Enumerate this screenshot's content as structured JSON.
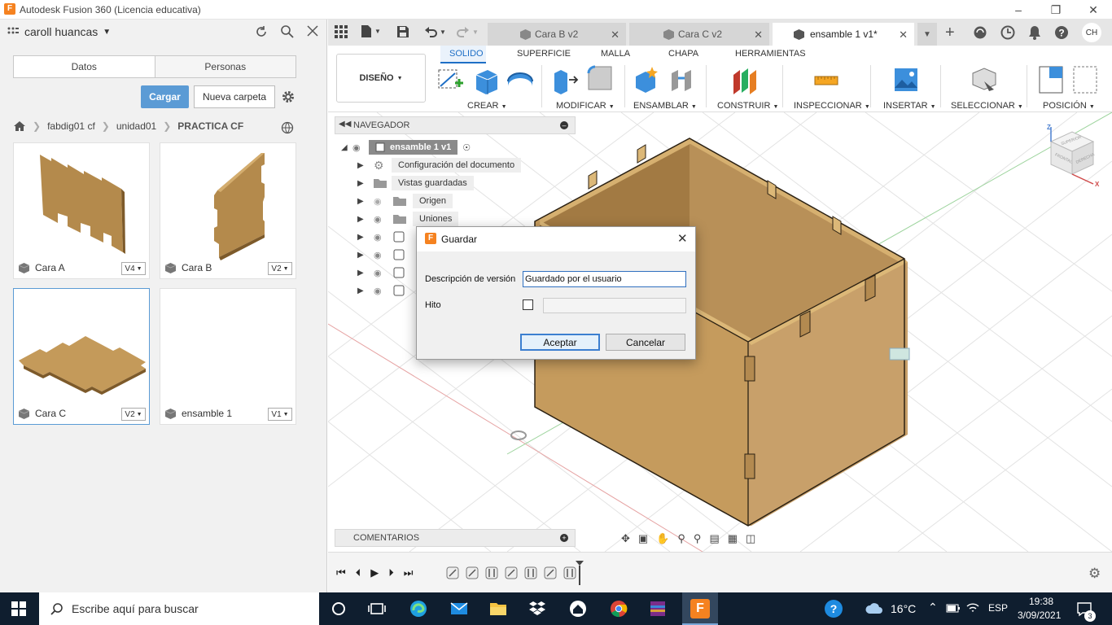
{
  "window": {
    "title": "Autodesk Fusion 360 (Licencia educativa)"
  },
  "left_panel": {
    "user": "caroll huancas",
    "tabs": [
      "Datos",
      "Personas"
    ],
    "upload_button": "Cargar",
    "new_folder_button": "Nueva carpeta",
    "breadcrumb": [
      "fabdig01 cf",
      "unidad01",
      "PRACTICA CF"
    ],
    "files": [
      {
        "name": "Cara A",
        "version": "V4"
      },
      {
        "name": "Cara B",
        "version": "V2"
      },
      {
        "name": "Cara C",
        "version": "V2"
      },
      {
        "name": "ensamble 1",
        "version": "V1"
      }
    ]
  },
  "doc_tabs": [
    {
      "label": "Cara B v2"
    },
    {
      "label": "Cara C v2"
    },
    {
      "label": "ensamble 1 v1*"
    }
  ],
  "user_initials": "CH",
  "toolbar": {
    "workspace": "DISEÑO",
    "tabs": [
      "SOLIDO",
      "SUPERFICIE",
      "MALLA",
      "CHAPA",
      "HERRAMIENTAS"
    ],
    "groups": [
      "CREAR",
      "MODIFICAR",
      "ENSAMBLAR",
      "CONSTRUIR",
      "INSPECCIONAR",
      "INSERTAR",
      "SELECCIONAR",
      "POSICIÓN"
    ]
  },
  "navigator": {
    "title": "NAVEGADOR",
    "root": "ensamble 1 v1",
    "items": [
      "Configuración del documento",
      "Vistas guardadas",
      "Origen",
      "Uniones"
    ]
  },
  "comments": {
    "title": "COMENTARIOS"
  },
  "viewcube": {
    "top": "SUPERIOR",
    "front": "FRONTAL",
    "right": "DERECHA",
    "z": "Z",
    "x": "X"
  },
  "dialog": {
    "title": "Guardar",
    "version_label": "Descripción de versión",
    "version_value": "Guardado por el usuario",
    "milestone_label": "Hito",
    "ok": "Aceptar",
    "cancel": "Cancelar"
  },
  "taskbar": {
    "search_placeholder": "Escribe aquí para buscar",
    "temperature": "16°C",
    "language": "ESP",
    "time": "19:38",
    "date": "3/09/2021",
    "notifications": "3"
  },
  "colors": {
    "accent": "#1e6fc6",
    "button_blue": "#5b9bd5",
    "wood": "#c49a5a",
    "fusion_orange": "#f58220"
  }
}
